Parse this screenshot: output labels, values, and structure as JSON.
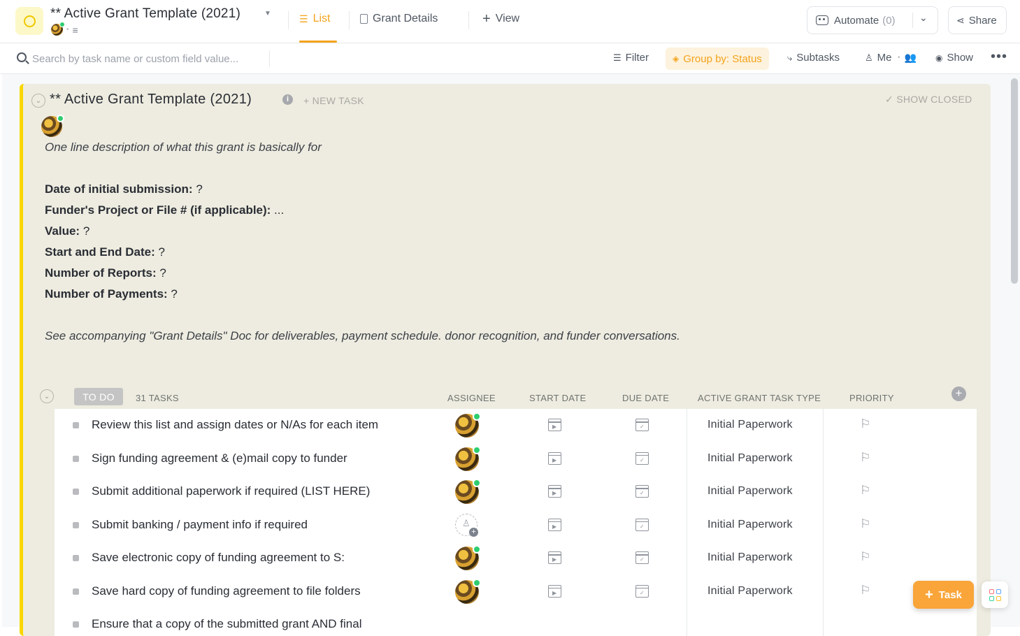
{
  "header": {
    "title": "** Active Grant Template (2021)",
    "tabs": [
      {
        "label": "List"
      },
      {
        "label": "Grant Details"
      },
      {
        "label": "View"
      }
    ],
    "automate_label": "Automate",
    "automate_count": "(0)",
    "share_label": "Share"
  },
  "toolbar": {
    "search_placeholder": "Search by task name or custom field value...",
    "filter_label": "Filter",
    "group_by_label": "Group by: Status",
    "subtasks_label": "Subtasks",
    "me_label": "Me",
    "show_label": "Show"
  },
  "group": {
    "title": "** Active Grant Template (2021)",
    "new_task_label": "+ NEW TASK",
    "show_closed_label": "SHOW CLOSED",
    "description_intro": "One line description of what this grant is basically for",
    "fields": [
      {
        "label": "Date of initial submission:",
        "value": " ?"
      },
      {
        "label": "Funder's Project or File # (if applicable):",
        "value": " ..."
      },
      {
        "label": "Value:",
        "value": " ?"
      },
      {
        "label": "Start and End Date:",
        "value": " ?"
      },
      {
        "label": "Number of Reports:",
        "value": " ?"
      },
      {
        "label": "Number of Payments:",
        "value": " ?"
      }
    ],
    "description_note": "See accompanying \"Grant Details\" Doc for deliverables, payment schedule. donor recognition, and funder conversations."
  },
  "status_group": {
    "status": "TO DO",
    "task_count": "31 TASKS",
    "columns": [
      "ASSIGNEE",
      "START DATE",
      "DUE DATE",
      "ACTIVE GRANT TASK TYPE",
      "PRIORITY"
    ]
  },
  "tasks": [
    {
      "name": "Review this list and assign dates or N/As for each item",
      "assigned": true,
      "type": "Initial Paperwork"
    },
    {
      "name": "Sign funding agreement & (e)mail copy to funder",
      "assigned": true,
      "type": "Initial Paperwork"
    },
    {
      "name": "Submit additional paperwork if required (LIST HERE)",
      "assigned": true,
      "type": "Initial Paperwork"
    },
    {
      "name": "Submit banking / payment info if required",
      "assigned": false,
      "type": "Initial Paperwork"
    },
    {
      "name": "Save electronic copy of funding agreement to S:",
      "assigned": true,
      "type": "Initial Paperwork"
    },
    {
      "name": "Save hard copy of funding agreement to file folders",
      "assigned": true,
      "type": "Initial Paperwork"
    },
    {
      "name": "Ensure that a copy of the submitted grant AND final",
      "assigned": false,
      "type": ""
    }
  ],
  "fab": {
    "task_label": "Task"
  },
  "colors": {
    "accent": "#f4a31c",
    "group_bg": "#eeece0",
    "group_border": "#fad700",
    "status_todo": "#c4c4c4"
  }
}
